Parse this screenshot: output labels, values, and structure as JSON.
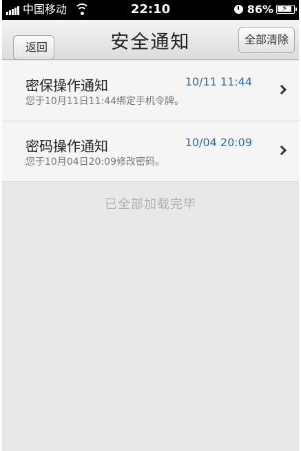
{
  "status_bar": {
    "carrier": "中国移动",
    "time": "22:10",
    "battery_percent": "86%"
  },
  "nav": {
    "back_label": "返回",
    "title": "安全通知",
    "clear_all_label": "全部清除"
  },
  "notifications": [
    {
      "title": "密保操作通知",
      "time": "10/11 11:44",
      "description": "您于10月11日11:44绑定手机令牌。"
    },
    {
      "title": "密码操作通知",
      "time": "10/04 20:09",
      "description": "您于10月04日20:09修改密码。"
    }
  ],
  "footer_text": "已全部加载完毕",
  "colors": {
    "time_text": "#2a6bb5",
    "background": "#e8e8e8"
  }
}
